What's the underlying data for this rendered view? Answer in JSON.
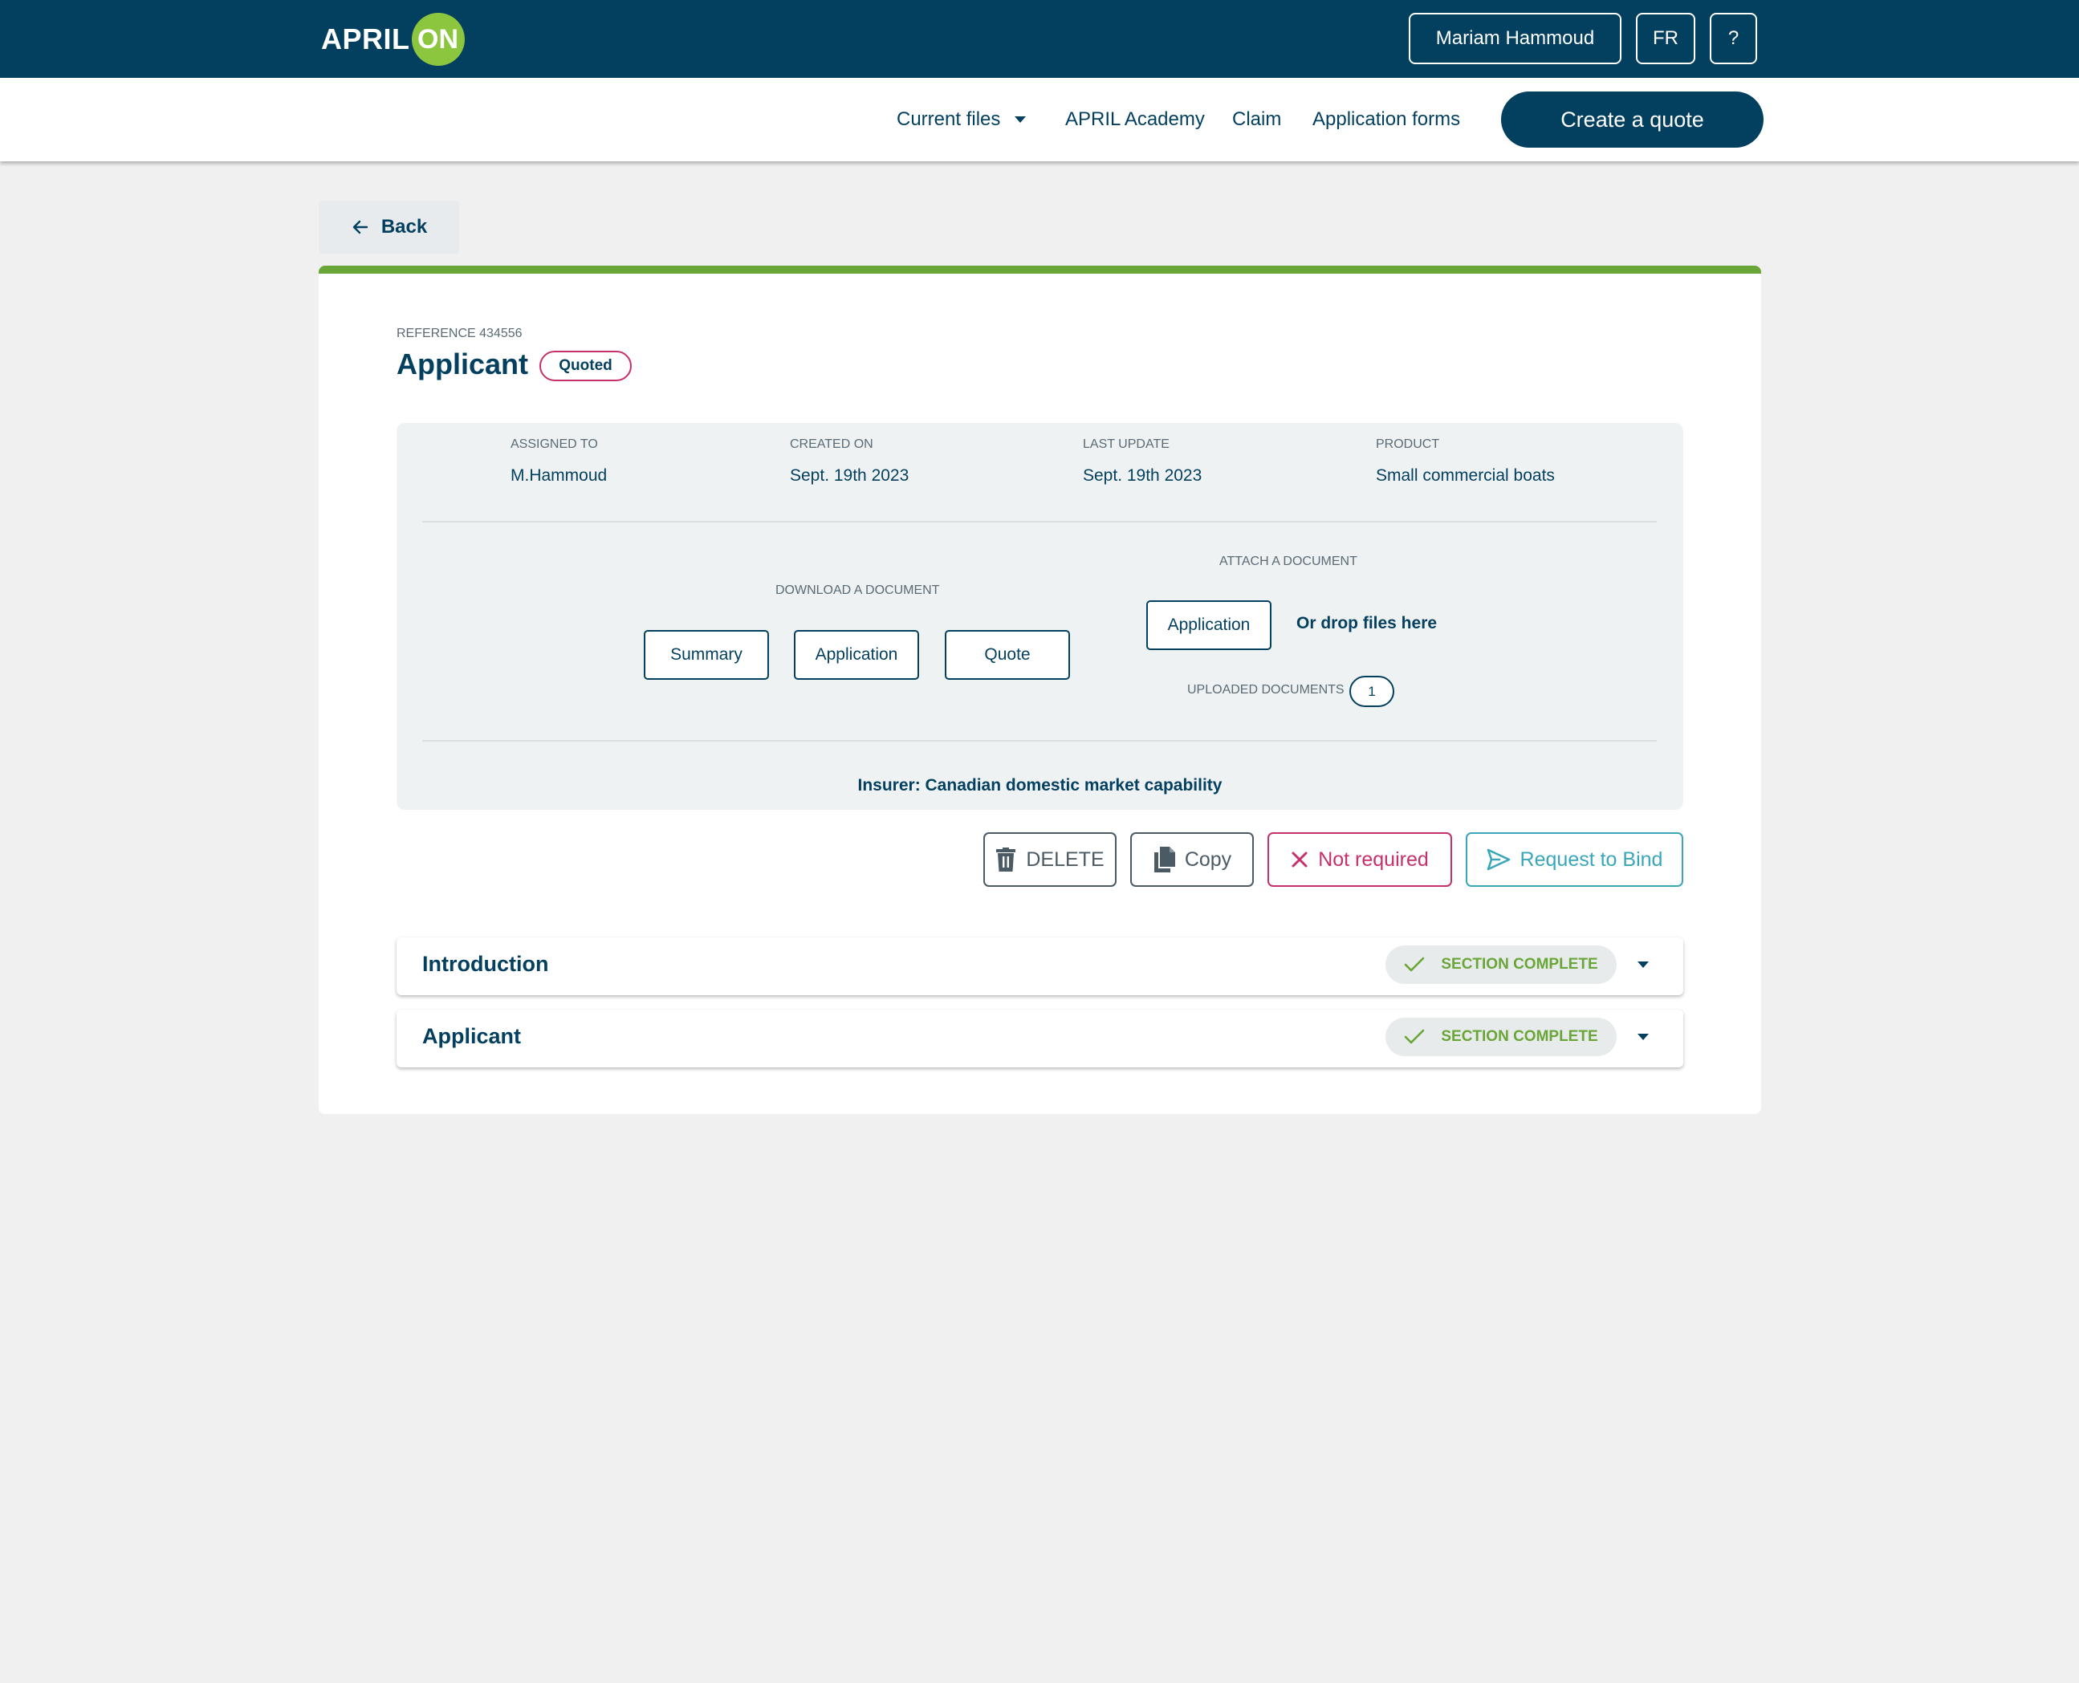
{
  "header": {
    "logo_text": "APRIL",
    "logo_badge": "ON",
    "user_name": "Mariam Hammoud",
    "language": "FR",
    "help": "?"
  },
  "nav": {
    "current_files": "Current files",
    "academy": "APRIL Academy",
    "claim": "Claim",
    "application_forms": "Application forms",
    "create_quote": "Create a quote"
  },
  "back_label": "Back",
  "file": {
    "reference": "REFERENCE 434556",
    "title": "Applicant",
    "status": "Quoted",
    "meta": [
      {
        "label": "ASSIGNED TO",
        "value": "M.Hammoud"
      },
      {
        "label": "CREATED ON",
        "value": "Sept. 19th 2023"
      },
      {
        "label": "LAST UPDATE",
        "value": "Sept. 19th 2023"
      },
      {
        "label": "PRODUCT",
        "value": "Small commercial boats"
      }
    ],
    "download_label": "DOWNLOAD A DOCUMENT",
    "download_buttons": [
      "Summary",
      "Application",
      "Quote"
    ],
    "attach_label": "ATTACH A DOCUMENT",
    "attach_button": "Application",
    "drop_text": "Or drop files here",
    "uploaded_label": "UPLOADED DOCUMENTS",
    "uploaded_count": "1",
    "insurer": "Insurer: Canadian domestic market capability"
  },
  "actions": {
    "delete": "DELETE",
    "copy": "Copy",
    "not_required": "Not required",
    "request_bind": "Request to Bind"
  },
  "sections": [
    {
      "title": "Introduction",
      "status": "SECTION COMPLETE"
    },
    {
      "title": "Applicant",
      "status": "SECTION COMPLETE"
    }
  ],
  "colors": {
    "primary": "#033f5f",
    "accent_green": "#6aa537",
    "logo_green": "#8cc63f",
    "danger": "#c6306c",
    "info": "#3aa6b9"
  }
}
